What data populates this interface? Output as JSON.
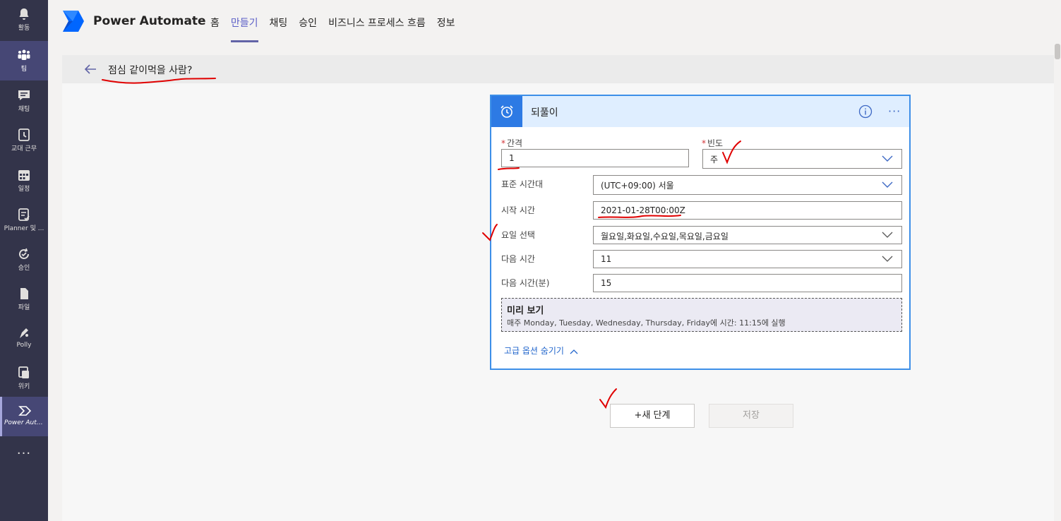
{
  "rail": {
    "items": [
      {
        "label": "활동",
        "icon": "bell-icon"
      },
      {
        "label": "팀",
        "icon": "teams-icon"
      },
      {
        "label": "채팅",
        "icon": "chat-icon"
      },
      {
        "label": "교대 근무",
        "icon": "shifts-clock-icon"
      },
      {
        "label": "일정",
        "icon": "calendar-icon"
      },
      {
        "label": "Planner 및 ...",
        "icon": "planner-icon"
      },
      {
        "label": "승인",
        "icon": "approvals-icon"
      },
      {
        "label": "파일",
        "icon": "files-icon"
      },
      {
        "label": "Polly",
        "icon": "polly-icon"
      },
      {
        "label": "위키",
        "icon": "wiki-icon"
      },
      {
        "label": "Power Auto...",
        "icon": "power-automate-icon"
      }
    ],
    "more": "···"
  },
  "app": {
    "name": "Power Automate",
    "tabs": [
      "홈",
      "만들기",
      "채팅",
      "승인",
      "비즈니스 프로세스 흐름",
      "정보"
    ],
    "active_tab": "만들기"
  },
  "flow": {
    "title": "점심 같이먹을 사람?"
  },
  "trigger": {
    "title": "되풀이",
    "interval_label": "간격",
    "interval_value": "1",
    "frequency_label": "빈도",
    "frequency_value": "주",
    "timezone_label": "표준 시간대",
    "timezone_value": "(UTC+09:00) 서울",
    "start_label": "시작 시간",
    "start_value": "2021-01-28T00:00Z",
    "weekdays_label": "요일 선택",
    "weekdays_value": "월요일,화요일,수요일,목요일,금요일",
    "hours_label": "다음 시간",
    "hours_value": "11",
    "minutes_label": "다음 시간(분)",
    "minutes_value": "15",
    "preview_title": "미리 보기",
    "preview_text": "매주 Monday, Tuesday, Wednesday, Thursday, Friday에 시간: 11:15에 실행",
    "advanced_link": "고급 옵션 숨기기",
    "required_mark": "*"
  },
  "actions": {
    "new_step": "+새 단계",
    "save": "저장"
  },
  "colors": {
    "rail_bg": "#33344a",
    "accent": "#6264a7",
    "card_border": "#3d8fe8",
    "card_header": "#dfeeff",
    "annotation": "#e00000"
  }
}
